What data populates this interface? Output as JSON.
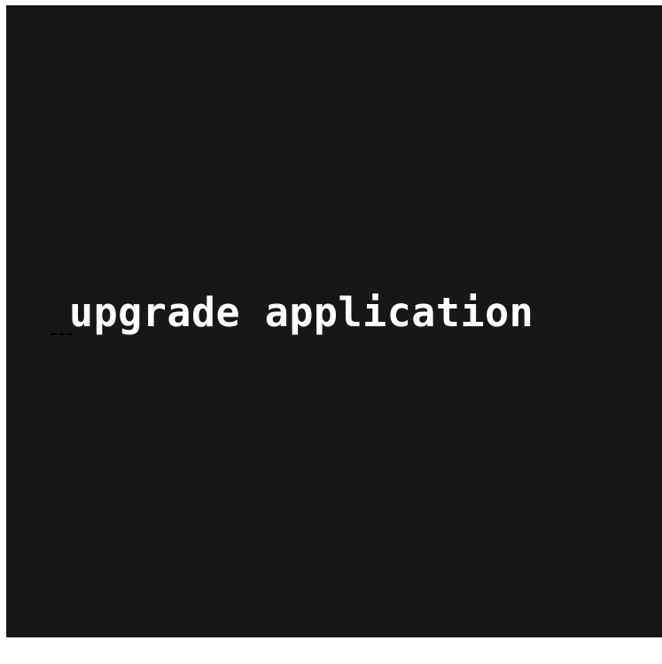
{
  "screen": {
    "message": "upgrade application",
    "background_color": "#171717",
    "text_color": "#ffffff"
  }
}
